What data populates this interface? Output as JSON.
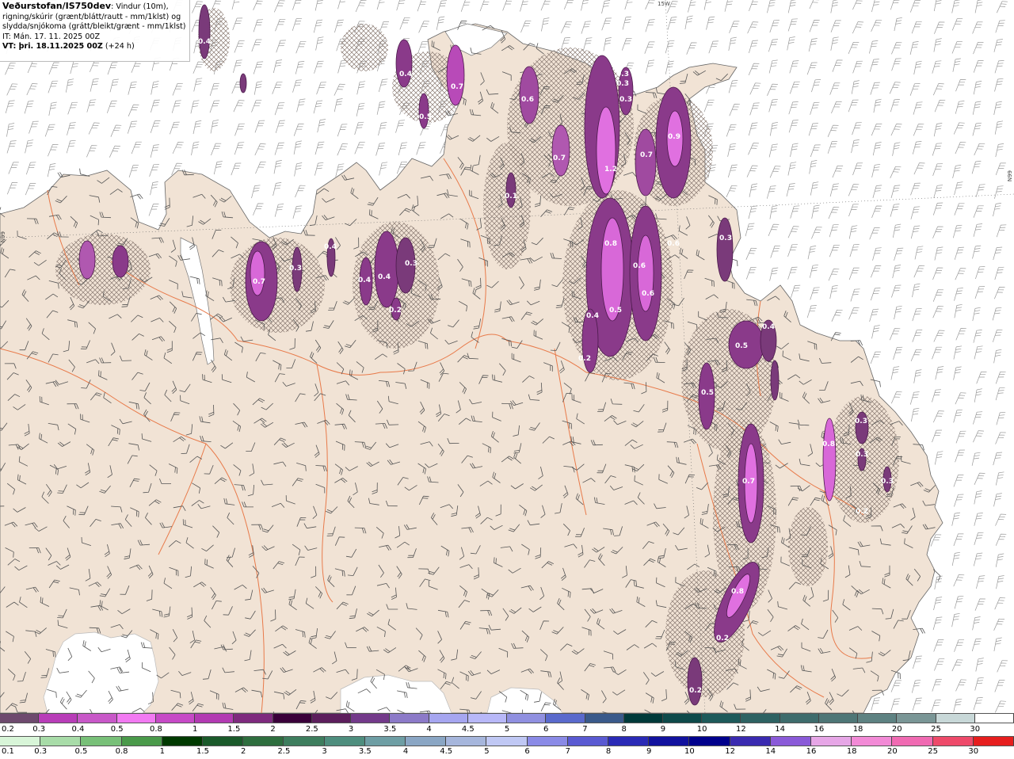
{
  "header": {
    "title_bold": "Veðurstofan/IS750dev",
    "title_rest": ": Vindur (10m),",
    "line2": "rigning/skúrir (grænt/blátt/rautt - mm/1klst) og",
    "line3": "slydda/snjókoma (grátt/bleikt/grænt - mm/1klst)",
    "it_line": "IT: Mán. 17. 11. 2025 00Z",
    "vt_bold": "VT: þri. 18.11.2025 00Z",
    "vt_rest": " (+24 h)"
  },
  "grid_labels": {
    "top": "15W",
    "left": "N99",
    "right": "N99"
  },
  "map_labels": [
    "0.4",
    "0.4",
    "0.7",
    "0.5",
    "0.6",
    "0.7",
    "1.2",
    "0.3",
    "0.3",
    "0.9",
    "0.7",
    "0.1",
    "0.3",
    "0.6",
    "0.4",
    "0.7",
    "0.3",
    "0.4",
    "0.4",
    "0.3",
    "0.2",
    "0.8",
    "0.6",
    "0.6",
    "0.4",
    "0.5",
    "0.2",
    "0.3",
    "0.5",
    "0.4",
    "0.5",
    "0.7",
    "0.3",
    "0.3",
    "0.3",
    "0.8",
    "0.2",
    "0.8",
    "0.2",
    "0.2"
  ],
  "legend_snow": {
    "labels": [
      "0.2",
      "0.3",
      "0.4",
      "0.5",
      "0.8",
      "1",
      "1.5",
      "2",
      "2.5",
      "3",
      "3.5",
      "4",
      "4.5",
      "5",
      "6",
      "7",
      "8",
      "9",
      "10",
      "12",
      "14",
      "16",
      "18",
      "20",
      "25",
      "30"
    ],
    "colors": [
      "#6e4a6e",
      "#b83db8",
      "#c858c8",
      "#f27af2",
      "#c64ac6",
      "#b23ab2",
      "#7e2a7e",
      "#3a003a",
      "#5c1e5c",
      "#733a8a",
      "#8c7ac8",
      "#a6a6f0",
      "#b8b8f8",
      "#9090e0",
      "#5a6acc",
      "#3a5a8a",
      "#003a3a",
      "#0e4a4a",
      "#1e5a5a",
      "#2e6262",
      "#3e6c6c",
      "#4e7676",
      "#5e8282",
      "#7a9696",
      "#c8d8d8",
      "#ffffff"
    ]
  },
  "legend_rain": {
    "labels": [
      "0.1",
      "0.3",
      "0.5",
      "0.8",
      "1",
      "1.5",
      "2",
      "2.5",
      "3",
      "3.5",
      "4",
      "4.5",
      "5",
      "6",
      "7",
      "8",
      "9",
      "10",
      "12",
      "14",
      "16",
      "18",
      "20",
      "25",
      "30"
    ],
    "colors": [
      "#d8f5d8",
      "#a8dca8",
      "#78c078",
      "#4a9a4a",
      "#003a00",
      "#1a5a2a",
      "#2e6e3e",
      "#3e7e5e",
      "#4e8e7e",
      "#6e9ea4",
      "#8aa6c4",
      "#a6b6dc",
      "#c0c8f4",
      "#8a8ae6",
      "#5a5ad2",
      "#2a2ab6",
      "#12129e",
      "#00008c",
      "#3a2ab0",
      "#8a5ad8",
      "#e6a6e6",
      "#f28ad6",
      "#f06ab2",
      "#ee4a6a",
      "#e61e1e"
    ]
  }
}
